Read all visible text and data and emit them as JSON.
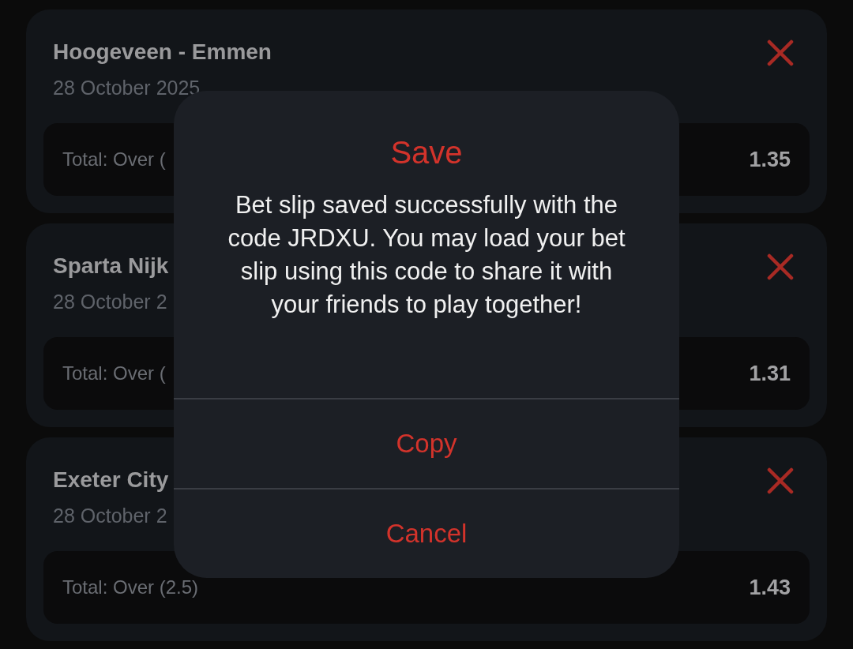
{
  "cards": [
    {
      "title": "Hoogeveen - Emmen",
      "date": "28 October 2025",
      "bet": "Total: Over (",
      "odds": "1.35"
    },
    {
      "title": "Sparta Nijk",
      "date": "28 October 2",
      "bet": "Total: Over (",
      "odds": "1.31"
    },
    {
      "title": "Exeter City",
      "date": "28 October 2",
      "bet": "Total: Over (2.5)",
      "odds": "1.43"
    }
  ],
  "dialog": {
    "title": "Save",
    "message": "Bet slip saved successfully with the code JRDXU. You may load your bet slip using this code to share it with your friends to play together!",
    "buttons": [
      "Copy",
      "Cancel"
    ]
  }
}
